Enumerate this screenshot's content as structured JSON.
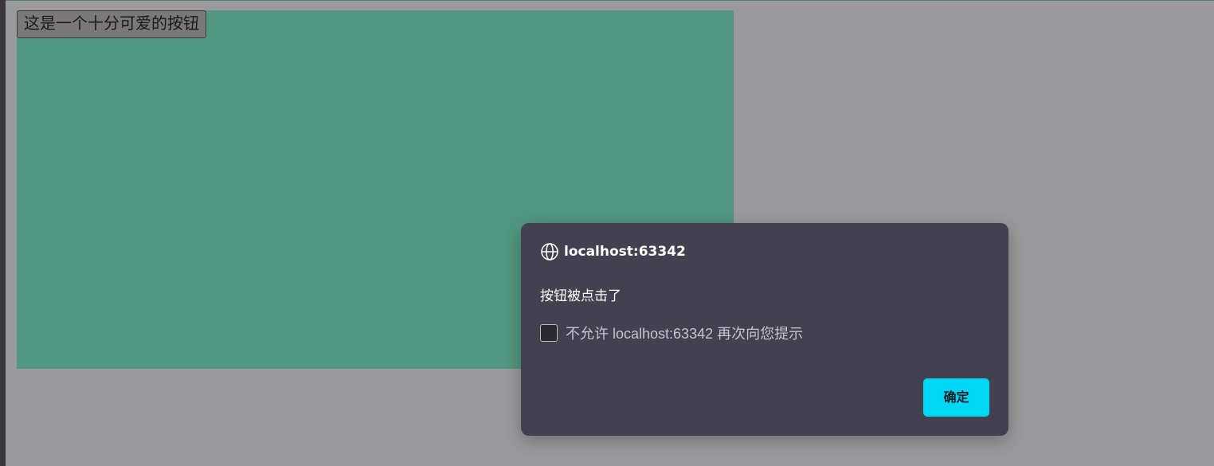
{
  "page": {
    "button_label": "这是一个十分可爱的按钮",
    "box_color": "#529782",
    "background_color": "#9a9a9c"
  },
  "dialog": {
    "origin": "localhost:63342",
    "origin_icon": "globe-icon",
    "message": "按钮被点击了",
    "checkbox_label": "不允许 localhost:63342 再次向您提示",
    "checkbox_checked": false,
    "ok_label": "确定",
    "background_color": "#43404f",
    "accent_color": "#00d7f5"
  }
}
